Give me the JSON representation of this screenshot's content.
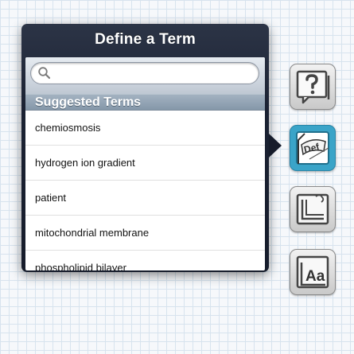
{
  "popover": {
    "title": "Define a Term",
    "search": {
      "placeholder": "",
      "value": ""
    },
    "section_header": "Suggested Terms",
    "terms": [
      "chemiosmosis",
      "hydrogen ion gradient",
      "patient",
      "mitochondrial membrane",
      "phospholipid bilayer"
    ]
  },
  "toolbar": {
    "buttons": [
      {
        "icon": "question-icon",
        "active": false
      },
      {
        "icon": "define-term-icon",
        "label": "Def",
        "active": true
      },
      {
        "icon": "notebook-icon",
        "active": false
      },
      {
        "icon": "text-size-icon",
        "label": "Aa",
        "active": false
      }
    ]
  },
  "colors": {
    "popover_dark": "#161c2b",
    "section_header": "#8597a9",
    "active_button": "#3aa4c8"
  }
}
